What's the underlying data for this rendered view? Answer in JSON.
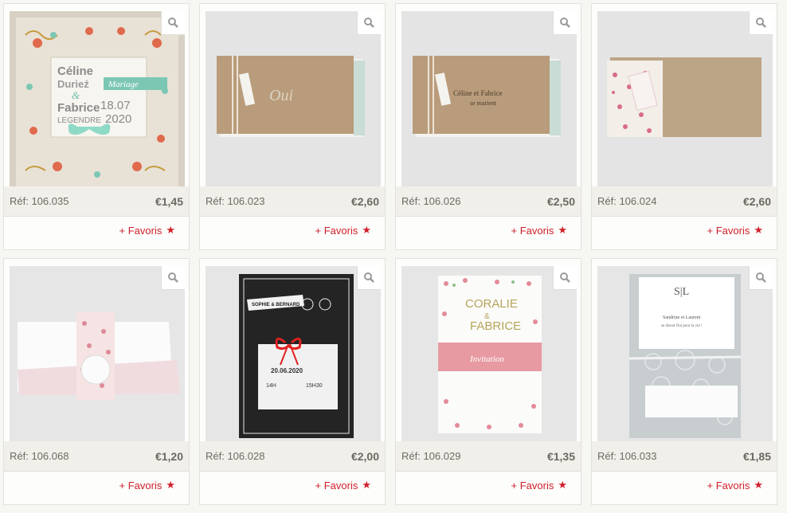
{
  "colors": {
    "accent": "#d0202c",
    "panel": "#f0efea",
    "background": "#f6f6f3"
  },
  "products": [
    {
      "ref": "Réf: 106.035",
      "price": "€1,45",
      "favoris": "+ Favoris",
      "art": {
        "names_top": "Céline",
        "names_mid": "Durieź",
        "amp": "&",
        "name3": "Fabrice",
        "name4": "LEGENDRE",
        "badge": "Mariage",
        "date1": "18.07",
        "date2": "2020"
      }
    },
    {
      "ref": "Réf: 106.023",
      "price": "€2,60",
      "favoris": "+ Favoris",
      "art": {
        "script": "Oui"
      }
    },
    {
      "ref": "Réf: 106.026",
      "price": "€2,50",
      "favoris": "+ Favoris",
      "art": {
        "line1": "Céline et Fabrice",
        "line2": "se marient"
      }
    },
    {
      "ref": "Réf: 106.024",
      "price": "€2,60",
      "favoris": "+ Favoris",
      "art": {}
    },
    {
      "ref": "Réf: 106.068",
      "price": "€1,20",
      "favoris": "+ Favoris",
      "art": {}
    },
    {
      "ref": "Réf: 106.028",
      "price": "€2,00",
      "favoris": "+ Favoris",
      "art": {
        "banner": "SOPHIE & BERNARD",
        "date": "20.06.2020",
        "t1": "14H",
        "t2": "15H30"
      }
    },
    {
      "ref": "Réf: 106.029",
      "price": "€1,35",
      "favoris": "+ Favoris",
      "art": {
        "n1": "CORALIE",
        "amp": "&",
        "n2": "FABRICE",
        "band": "Invitation"
      }
    },
    {
      "ref": "Réf: 106.033",
      "price": "€1,85",
      "favoris": "+ Favoris",
      "art": {
        "mono": "S|L",
        "names": "Sandrine et Laurent",
        "sub": "se disent Oui pour la vie !"
      }
    }
  ]
}
